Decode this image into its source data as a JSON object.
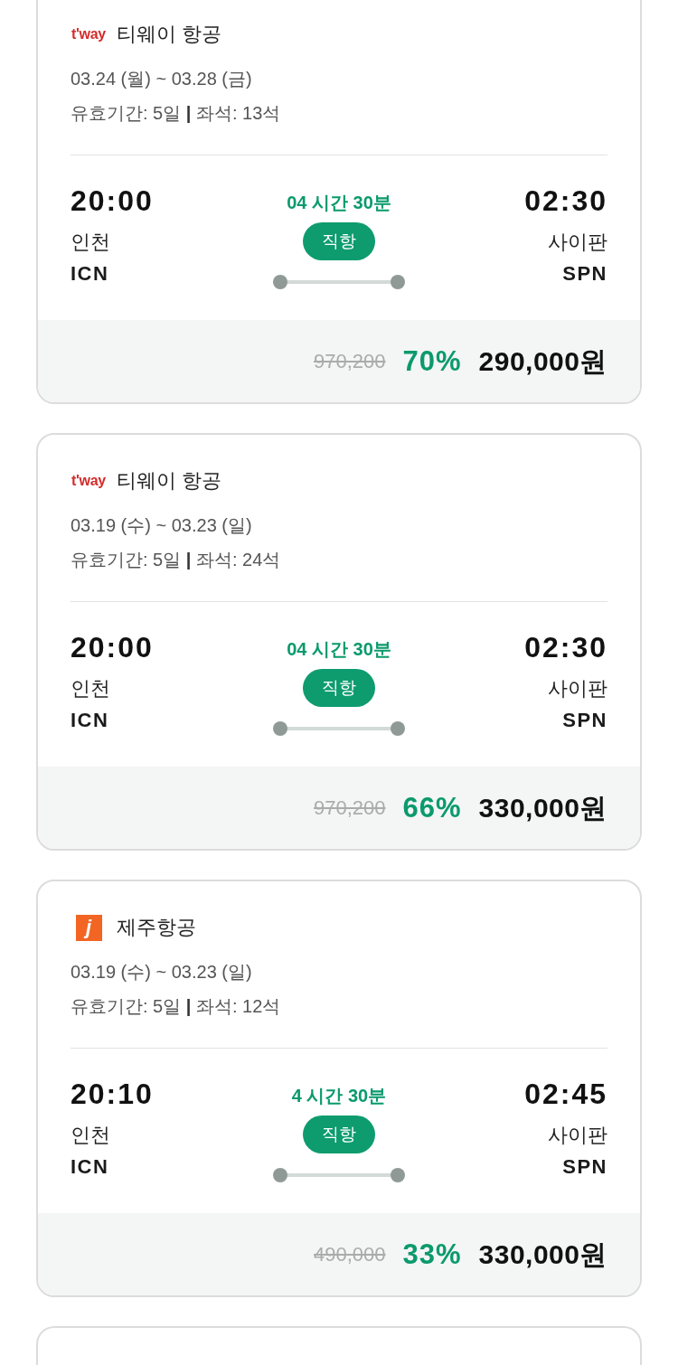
{
  "flights": [
    {
      "airline": {
        "logo": {
          "kind": "tway",
          "text": "t'way"
        },
        "name": "티웨이 항공"
      },
      "dates": "03.24 (월) ~ 03.28 (금)",
      "validity": "유효기간: 5일 **|** 좌석: 13석",
      "departure": {
        "time": "20:00",
        "city": "인천",
        "code": "ICN"
      },
      "duration": "04 시간 30분",
      "route_type": "직항",
      "arrival": {
        "time": "02:30",
        "city": "사이판",
        "code": "SPN"
      },
      "original_price": "970,200",
      "discount": "70%",
      "price": "290,000원"
    },
    {
      "airline": {
        "logo": {
          "kind": "tway",
          "text": "t'way"
        },
        "name": "티웨이 항공"
      },
      "dates": "03.19 (수) ~ 03.23 (일)",
      "validity": "유효기간: 5일 **|** 좌석: 24석",
      "departure": {
        "time": "20:00",
        "city": "인천",
        "code": "ICN"
      },
      "duration": "04 시간 30분",
      "route_type": "직항",
      "arrival": {
        "time": "02:30",
        "city": "사이판",
        "code": "SPN"
      },
      "original_price": "970,200",
      "discount": "66%",
      "price": "330,000원"
    },
    {
      "airline": {
        "logo": {
          "kind": "jeju",
          "text": "j"
        },
        "name": "제주항공"
      },
      "dates": "03.19 (수) ~ 03.23 (일)",
      "validity": "유효기간: 5일 **|** 좌석: 12석",
      "departure": {
        "time": "20:10",
        "city": "인천",
        "code": "ICN"
      },
      "duration": "4 시간 30분",
      "route_type": "직항",
      "arrival": {
        "time": "02:45",
        "city": "사이판",
        "code": "SPN"
      },
      "original_price": "490,000",
      "discount": "33%",
      "price": "330,000원"
    }
  ],
  "clipped_card_below": true
}
